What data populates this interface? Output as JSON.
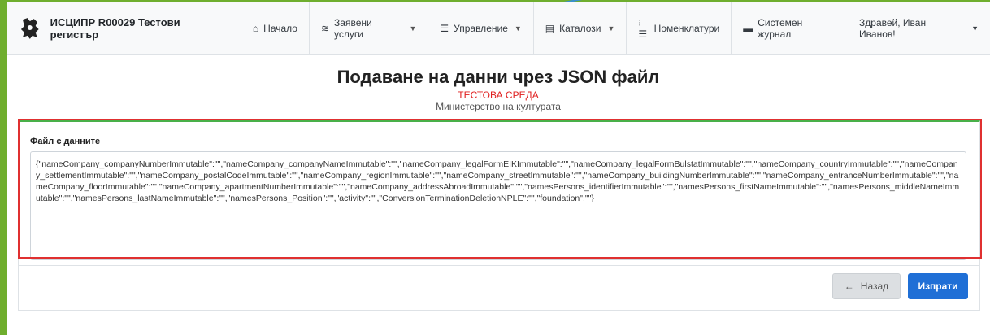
{
  "navbar": {
    "brand": "ИСЦИПР R00029 Тестови регистър",
    "items": [
      {
        "label": "Начало",
        "icon": "home-icon"
      },
      {
        "label": "Заявени услуги",
        "icon": "layers-icon"
      },
      {
        "label": "Управление",
        "icon": "sliders-icon"
      },
      {
        "label": "Каталози",
        "icon": "catalog-icon"
      },
      {
        "label": "Номенклатури",
        "icon": "list-icon"
      },
      {
        "label": "Системен журнал",
        "icon": "journal-icon"
      }
    ],
    "user": "Здравей, Иван Иванов!"
  },
  "page": {
    "title": "Подаване на данни чрез JSON файл",
    "environment": "ТЕСТОВА СРЕДА",
    "ministry": "Министерство на културата"
  },
  "form": {
    "label": "Файл с данните",
    "json_value": "{\"nameCompany_companyNumberImmutable\":\"\",\"nameCompany_companyNameImmutable\":\"\",\"nameCompany_legalFormEIKImmutable\":\"\",\"nameCompany_legalFormBulstatImmutable\":\"\",\"nameCompany_countryImmutable\":\"\",\"nameCompany_settlementImmutable\":\"\",\"nameCompany_postalCodeImmutable\":\"\",\"nameCompany_regionImmutable\":\"\",\"nameCompany_streetImmutable\":\"\",\"nameCompany_buildingNumberImmutable\":\"\",\"nameCompany_entranceNumberImmutable\":\"\",\"nameCompany_floorImmutable\":\"\",\"nameCompany_apartmentNumberImmutable\":\"\",\"nameCompany_addressAbroadImmutable\":\"\",\"namesPersons_identifierImmutable\":\"\",\"namesPersons_firstNameImmutable\":\"\",\"namesPersons_middleNameImmutable\":\"\",\"namesPersons_lastNameImmutable\":\"\",\"namesPersons_Position\":\"\",\"activity\":\"\",\"ConversionTerminationDeletionNPLE\":\"\",\"foundation\":\"\"}",
    "back_label": "Назад",
    "send_label": "Изпрати"
  },
  "colors": {
    "accent": "#1f6fd6",
    "env_red": "#e02020",
    "frame_green": "#6fae2e",
    "highlight_red": "#e03030"
  }
}
